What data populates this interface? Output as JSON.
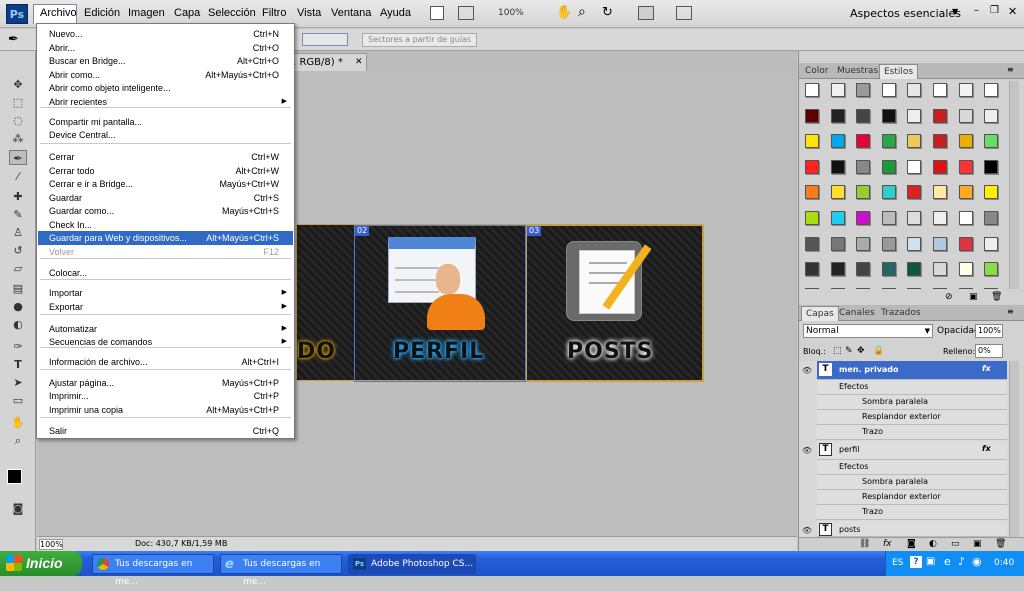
{
  "app": {
    "logo": "Ps",
    "workspace": "Aspectos esenciales",
    "zoom": "100%"
  },
  "menubar": {
    "items": [
      "Archivo",
      "Edición",
      "Imagen",
      "Capa",
      "Selección",
      "Filtro",
      "Vista",
      "Ventana",
      "Ayuda"
    ]
  },
  "options_bar": {
    "slices_button": "Sectores a partir de guías"
  },
  "document": {
    "tab_title": "o, RGB/8) *",
    "zoom": "100%",
    "doc_info": "Doc: 430,7 KB/1,59 MB"
  },
  "banner": {
    "slices": [
      {
        "tag": "02"
      },
      {
        "tag": "03"
      }
    ],
    "labels": {
      "left_partial": "DO",
      "perfil": "PERFIL",
      "posts": "POSTS"
    }
  },
  "file_menu": {
    "items": [
      {
        "label": "Nuevo...",
        "shortcut": "Ctrl+N"
      },
      {
        "label": "Abrir...",
        "shortcut": "Ctrl+O"
      },
      {
        "label": "Buscar en Bridge...",
        "shortcut": "Alt+Ctrl+O"
      },
      {
        "label": "Abrir como...",
        "shortcut": "Alt+Mayús+Ctrl+O"
      },
      {
        "label": "Abrir como objeto inteligente...",
        "shortcut": ""
      },
      {
        "label": "Abrir recientes",
        "shortcut": ""
      },
      {
        "label": "Compartir mi pantalla...",
        "shortcut": ""
      },
      {
        "label": "Device Central...",
        "shortcut": ""
      },
      {
        "label": "Cerrar",
        "shortcut": "Ctrl+W"
      },
      {
        "label": "Cerrar todo",
        "shortcut": "Alt+Ctrl+W"
      },
      {
        "label": "Cerrar e ir a Bridge...",
        "shortcut": "Mayús+Ctrl+W"
      },
      {
        "label": "Guardar",
        "shortcut": "Ctrl+S"
      },
      {
        "label": "Guardar como...",
        "shortcut": "Mayús+Ctrl+S"
      },
      {
        "label": "Check In...",
        "shortcut": ""
      },
      {
        "label": "Guardar para Web y dispositivos...",
        "shortcut": "Alt+Mayús+Ctrl+S"
      },
      {
        "label": "Volver",
        "shortcut": "F12"
      },
      {
        "label": "Colocar...",
        "shortcut": ""
      },
      {
        "label": "Importar",
        "shortcut": ""
      },
      {
        "label": "Exportar",
        "shortcut": ""
      },
      {
        "label": "Automatizar",
        "shortcut": ""
      },
      {
        "label": "Secuencias de comandos",
        "shortcut": ""
      },
      {
        "label": "Información de archivo...",
        "shortcut": "Alt+Ctrl+I"
      },
      {
        "label": "Ajustar página...",
        "shortcut": "Mayús+Ctrl+P"
      },
      {
        "label": "Imprimir...",
        "shortcut": "Ctrl+P"
      },
      {
        "label": "Imprimir una copia",
        "shortcut": "Alt+Mayús+Ctrl+P"
      },
      {
        "label": "Salir",
        "shortcut": "Ctrl+Q"
      }
    ]
  },
  "styles_panel": {
    "tabs": [
      "Color",
      "Muestras",
      "Estilos"
    ]
  },
  "layers_panel": {
    "tabs": [
      "Capas",
      "Canales",
      "Trazados"
    ],
    "blend_mode": "Normal",
    "opacity_label": "Opacidad:",
    "opacity": "100%",
    "lock_label": "Bloq.:",
    "fill_label": "Relleno:",
    "fill": "0%",
    "layers": [
      {
        "name": "men. privado",
        "effects_label": "Efectos",
        "effects": [
          "Sombra paralela",
          "Resplandor exterior",
          "Trazo"
        ]
      },
      {
        "name": "perfil",
        "effects_label": "Efectos",
        "effects": [
          "Sombra paralela",
          "Resplandor exterior",
          "Trazo"
        ]
      },
      {
        "name": "posts"
      }
    ]
  },
  "taskbar": {
    "start_label": "Inicio",
    "tasks": [
      "Tus descargas en me...",
      "Tus descargas en me...",
      "Adobe Photoshop CS..."
    ],
    "lang": "ES",
    "clock": "0:40"
  },
  "colors": {
    "highlight": "#316ac5",
    "slice_border": "#5577cc",
    "banner_border": "#c7a24a",
    "perfil_glow": "#1ea6ff",
    "posts_glow": "#ffffff",
    "do_glow": "#f5b800"
  }
}
